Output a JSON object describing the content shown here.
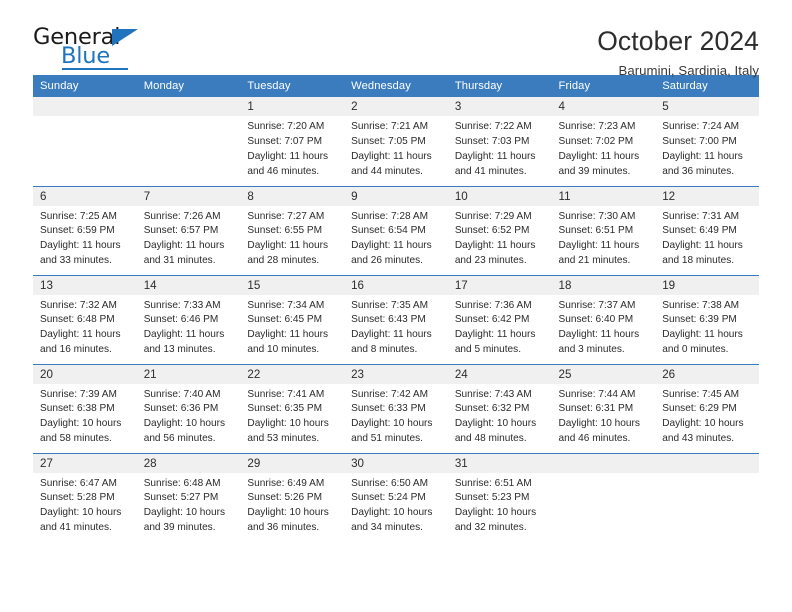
{
  "brand": {
    "name_top": "General",
    "name_bottom": "Blue",
    "accent_color": "#1f74bd"
  },
  "header": {
    "title": "October 2024",
    "subtitle": "Barumini, Sardinia, Italy"
  },
  "calendar": {
    "header_color": "#3a7cbe",
    "daynum_bg": "#f0f0f0",
    "weekday_headers": [
      "Sunday",
      "Monday",
      "Tuesday",
      "Wednesday",
      "Thursday",
      "Friday",
      "Saturday"
    ],
    "weeks": [
      [
        {
          "day": "",
          "lines": []
        },
        {
          "day": "",
          "lines": []
        },
        {
          "day": "1",
          "lines": [
            "Sunrise: 7:20 AM",
            "Sunset: 7:07 PM",
            "Daylight: 11 hours",
            "and 46 minutes."
          ]
        },
        {
          "day": "2",
          "lines": [
            "Sunrise: 7:21 AM",
            "Sunset: 7:05 PM",
            "Daylight: 11 hours",
            "and 44 minutes."
          ]
        },
        {
          "day": "3",
          "lines": [
            "Sunrise: 7:22 AM",
            "Sunset: 7:03 PM",
            "Daylight: 11 hours",
            "and 41 minutes."
          ]
        },
        {
          "day": "4",
          "lines": [
            "Sunrise: 7:23 AM",
            "Sunset: 7:02 PM",
            "Daylight: 11 hours",
            "and 39 minutes."
          ]
        },
        {
          "day": "5",
          "lines": [
            "Sunrise: 7:24 AM",
            "Sunset: 7:00 PM",
            "Daylight: 11 hours",
            "and 36 minutes."
          ]
        }
      ],
      [
        {
          "day": "6",
          "lines": [
            "Sunrise: 7:25 AM",
            "Sunset: 6:59 PM",
            "Daylight: 11 hours",
            "and 33 minutes."
          ]
        },
        {
          "day": "7",
          "lines": [
            "Sunrise: 7:26 AM",
            "Sunset: 6:57 PM",
            "Daylight: 11 hours",
            "and 31 minutes."
          ]
        },
        {
          "day": "8",
          "lines": [
            "Sunrise: 7:27 AM",
            "Sunset: 6:55 PM",
            "Daylight: 11 hours",
            "and 28 minutes."
          ]
        },
        {
          "day": "9",
          "lines": [
            "Sunrise: 7:28 AM",
            "Sunset: 6:54 PM",
            "Daylight: 11 hours",
            "and 26 minutes."
          ]
        },
        {
          "day": "10",
          "lines": [
            "Sunrise: 7:29 AM",
            "Sunset: 6:52 PM",
            "Daylight: 11 hours",
            "and 23 minutes."
          ]
        },
        {
          "day": "11",
          "lines": [
            "Sunrise: 7:30 AM",
            "Sunset: 6:51 PM",
            "Daylight: 11 hours",
            "and 21 minutes."
          ]
        },
        {
          "day": "12",
          "lines": [
            "Sunrise: 7:31 AM",
            "Sunset: 6:49 PM",
            "Daylight: 11 hours",
            "and 18 minutes."
          ]
        }
      ],
      [
        {
          "day": "13",
          "lines": [
            "Sunrise: 7:32 AM",
            "Sunset: 6:48 PM",
            "Daylight: 11 hours",
            "and 16 minutes."
          ]
        },
        {
          "day": "14",
          "lines": [
            "Sunrise: 7:33 AM",
            "Sunset: 6:46 PM",
            "Daylight: 11 hours",
            "and 13 minutes."
          ]
        },
        {
          "day": "15",
          "lines": [
            "Sunrise: 7:34 AM",
            "Sunset: 6:45 PM",
            "Daylight: 11 hours",
            "and 10 minutes."
          ]
        },
        {
          "day": "16",
          "lines": [
            "Sunrise: 7:35 AM",
            "Sunset: 6:43 PM",
            "Daylight: 11 hours",
            "and 8 minutes."
          ]
        },
        {
          "day": "17",
          "lines": [
            "Sunrise: 7:36 AM",
            "Sunset: 6:42 PM",
            "Daylight: 11 hours",
            "and 5 minutes."
          ]
        },
        {
          "day": "18",
          "lines": [
            "Sunrise: 7:37 AM",
            "Sunset: 6:40 PM",
            "Daylight: 11 hours",
            "and 3 minutes."
          ]
        },
        {
          "day": "19",
          "lines": [
            "Sunrise: 7:38 AM",
            "Sunset: 6:39 PM",
            "Daylight: 11 hours",
            "and 0 minutes."
          ]
        }
      ],
      [
        {
          "day": "20",
          "lines": [
            "Sunrise: 7:39 AM",
            "Sunset: 6:38 PM",
            "Daylight: 10 hours",
            "and 58 minutes."
          ]
        },
        {
          "day": "21",
          "lines": [
            "Sunrise: 7:40 AM",
            "Sunset: 6:36 PM",
            "Daylight: 10 hours",
            "and 56 minutes."
          ]
        },
        {
          "day": "22",
          "lines": [
            "Sunrise: 7:41 AM",
            "Sunset: 6:35 PM",
            "Daylight: 10 hours",
            "and 53 minutes."
          ]
        },
        {
          "day": "23",
          "lines": [
            "Sunrise: 7:42 AM",
            "Sunset: 6:33 PM",
            "Daylight: 10 hours",
            "and 51 minutes."
          ]
        },
        {
          "day": "24",
          "lines": [
            "Sunrise: 7:43 AM",
            "Sunset: 6:32 PM",
            "Daylight: 10 hours",
            "and 48 minutes."
          ]
        },
        {
          "day": "25",
          "lines": [
            "Sunrise: 7:44 AM",
            "Sunset: 6:31 PM",
            "Daylight: 10 hours",
            "and 46 minutes."
          ]
        },
        {
          "day": "26",
          "lines": [
            "Sunrise: 7:45 AM",
            "Sunset: 6:29 PM",
            "Daylight: 10 hours",
            "and 43 minutes."
          ]
        }
      ],
      [
        {
          "day": "27",
          "lines": [
            "Sunrise: 6:47 AM",
            "Sunset: 5:28 PM",
            "Daylight: 10 hours",
            "and 41 minutes."
          ]
        },
        {
          "day": "28",
          "lines": [
            "Sunrise: 6:48 AM",
            "Sunset: 5:27 PM",
            "Daylight: 10 hours",
            "and 39 minutes."
          ]
        },
        {
          "day": "29",
          "lines": [
            "Sunrise: 6:49 AM",
            "Sunset: 5:26 PM",
            "Daylight: 10 hours",
            "and 36 minutes."
          ]
        },
        {
          "day": "30",
          "lines": [
            "Sunrise: 6:50 AM",
            "Sunset: 5:24 PM",
            "Daylight: 10 hours",
            "and 34 minutes."
          ]
        },
        {
          "day": "31",
          "lines": [
            "Sunrise: 6:51 AM",
            "Sunset: 5:23 PM",
            "Daylight: 10 hours",
            "and 32 minutes."
          ]
        },
        {
          "day": "",
          "lines": []
        },
        {
          "day": "",
          "lines": []
        }
      ]
    ]
  }
}
